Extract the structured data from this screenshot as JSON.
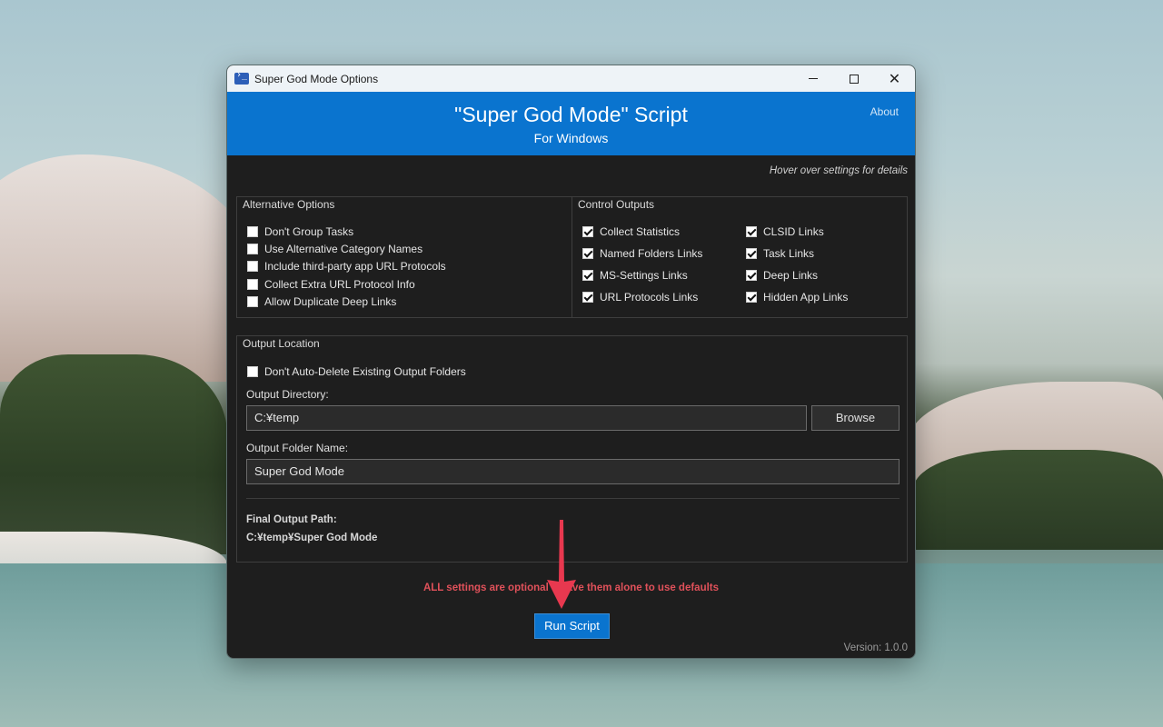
{
  "window": {
    "title": "Super God Mode Options",
    "controls": {
      "minimize": "minimize",
      "maximize": "maximize",
      "close": "close"
    }
  },
  "header": {
    "title": "\"Super God Mode\" Script",
    "subtitle": "For Windows",
    "about_label": "About"
  },
  "hint": "Hover over settings for details",
  "alternative_options": {
    "legend": "Alternative Options",
    "items": [
      {
        "label": "Don't Group Tasks",
        "checked": false
      },
      {
        "label": "Use Alternative Category Names",
        "checked": false
      },
      {
        "label": "Include third-party app URL Protocols",
        "checked": false
      },
      {
        "label": "Collect Extra URL Protocol Info",
        "checked": false
      },
      {
        "label": "Allow Duplicate Deep Links",
        "checked": false
      }
    ]
  },
  "control_outputs": {
    "legend": "Control Outputs",
    "items": [
      {
        "label": "Collect Statistics",
        "checked": true
      },
      {
        "label": "Named Folders Links",
        "checked": true
      },
      {
        "label": "MS-Settings Links",
        "checked": true
      },
      {
        "label": "URL Protocols Links",
        "checked": true
      },
      {
        "label": "CLSID Links",
        "checked": true
      },
      {
        "label": "Task Links",
        "checked": true
      },
      {
        "label": "Deep Links",
        "checked": true
      },
      {
        "label": "Hidden App Links",
        "checked": true
      }
    ]
  },
  "output_location": {
    "legend": "Output Location",
    "auto_delete": {
      "label": "Don't Auto-Delete Existing Output Folders",
      "checked": false
    },
    "directory_label": "Output Directory:",
    "directory_value": "C:¥temp",
    "browse_label": "Browse",
    "folder_name_label": "Output Folder Name:",
    "folder_name_value": "Super God Mode",
    "final_path_label": "Final Output Path:",
    "final_path_value": "C:¥temp¥Super God Mode"
  },
  "footer": {
    "warning": "ALL settings are optional - leave them alone to use defaults",
    "run_label": "Run Script",
    "version": "Version: 1.0.0"
  },
  "colors": {
    "accent": "#0a74cf",
    "warning": "#e0515a",
    "annotation_arrow": "#e8384f"
  }
}
